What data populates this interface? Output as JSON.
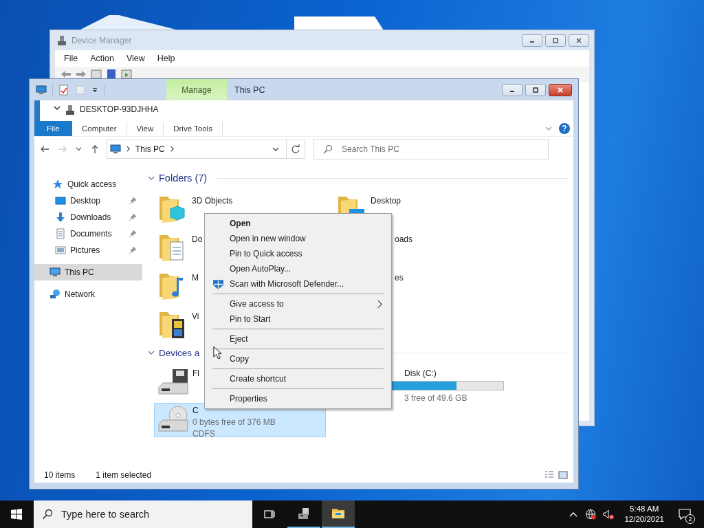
{
  "device_manager": {
    "title": "Device Manager",
    "menu": [
      "File",
      "Action",
      "View",
      "Help"
    ],
    "tree_root": "DESKTOP-93DJHHA"
  },
  "explorer": {
    "context_tab": "Manage",
    "title": "This PC",
    "ribbon_tabs": [
      {
        "label": "File",
        "kind": "file",
        "selected": false
      },
      {
        "label": "Computer",
        "kind": "tab",
        "selected": false
      },
      {
        "label": "View",
        "kind": "tab",
        "selected": false
      },
      {
        "label": "Drive Tools",
        "kind": "tab",
        "selected": false
      }
    ],
    "help_button": "?",
    "address": "This PC",
    "search": {
      "placeholder": "Search This PC"
    },
    "nav": [
      {
        "label": "Quick access",
        "selected": false,
        "children": [
          {
            "label": "Desktop",
            "pinned": true,
            "selected": false
          },
          {
            "label": "Downloads",
            "pinned": true,
            "selected": false
          },
          {
            "label": "Documents",
            "pinned": true,
            "selected": false
          },
          {
            "label": "Pictures",
            "pinned": true,
            "selected": false
          }
        ]
      },
      {
        "label": "This PC",
        "selected": true
      },
      {
        "label": "Network",
        "selected": false
      }
    ],
    "folders": {
      "title": "Folders (7)",
      "items": [
        {
          "name": "3D Objects"
        },
        {
          "name": "Desktop"
        },
        {
          "name": "Do"
        },
        {
          "name": "oads",
          "clipped": true
        },
        {
          "name": "M"
        },
        {
          "name": "es",
          "clipped": true
        },
        {
          "name": "Vi"
        }
      ]
    },
    "devices": {
      "title": "Devices a",
      "items": [
        {
          "name": "Fl",
          "kind": "floppy",
          "selected": false
        },
        {
          "name": "Disk (C:)",
          "clipped": true,
          "level": 0.63,
          "free": "3 free of 49.6 GB",
          "selected": false
        },
        {
          "name": "C",
          "kind": "cd",
          "free": "0 bytes free of 376 MB",
          "filesystem": "CDFS",
          "selected": true
        }
      ]
    },
    "status": {
      "items": "10 items",
      "selection": "1 item selected"
    }
  },
  "context_menu": [
    {
      "kind": "item",
      "label": "Open",
      "default": true
    },
    {
      "kind": "item",
      "label": "Open in new window",
      "default": false
    },
    {
      "kind": "item",
      "label": "Pin to Quick access",
      "default": false
    },
    {
      "kind": "item",
      "label": "Open AutoPlay...",
      "default": false
    },
    {
      "kind": "icon_item",
      "label": "Scan with Microsoft Defender...",
      "default": false
    },
    {
      "kind": "separator"
    },
    {
      "kind": "item",
      "label": "Give access to",
      "default": false,
      "submenu": true
    },
    {
      "kind": "item",
      "label": "Pin to Start",
      "default": false
    },
    {
      "kind": "separator"
    },
    {
      "kind": "item",
      "label": "Eject",
      "default": false
    },
    {
      "kind": "separator"
    },
    {
      "kind": "item",
      "label": "Copy",
      "default": false
    },
    {
      "kind": "separator"
    },
    {
      "kind": "item",
      "label": "Create shortcut",
      "default": false
    },
    {
      "kind": "separator"
    },
    {
      "kind": "item",
      "label": "Properties",
      "default": false
    }
  ],
  "taskbar": {
    "search": {
      "placeholder": "Type here to search"
    },
    "apps": [
      {
        "selected": false
      },
      {
        "selected": true
      }
    ],
    "time": "5:48 AM",
    "date": "12/20/2021",
    "notifications": "2"
  }
}
